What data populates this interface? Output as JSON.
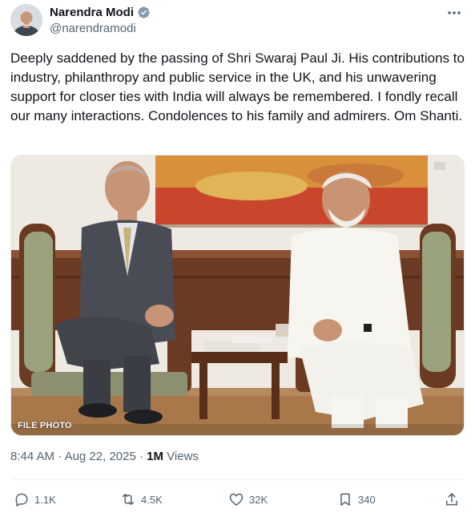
{
  "author": {
    "display_name": "Narendra Modi",
    "handle": "@narendramodi",
    "verified": true,
    "verified_color": "#829aab"
  },
  "post": {
    "text": "Deeply saddened by the passing of Shri Swaraj Paul Ji. His contributions to industry, philanthropy and public service in the UK, and his unwavering support for closer ties with India will always be remembered. I fondly recall our many interactions. Condolences to his family and admirers. Om Shanti.",
    "media_label": "FILE PHOTO",
    "time": "8:44 AM",
    "separator": " · ",
    "date": "Aug 22, 2025",
    "views_count": "1M",
    "views_label": " Views"
  },
  "actions": {
    "replies": "1.1K",
    "reposts": "4.5K",
    "likes": "32K",
    "bookmarks": "340"
  },
  "icons": {
    "more": "more-icon",
    "verified": "verified-badge-icon",
    "reply": "reply-icon",
    "repost": "repost-icon",
    "like": "heart-icon",
    "bookmark": "bookmark-icon",
    "share": "share-icon"
  },
  "colors": {
    "text_primary": "#0f1419",
    "text_secondary": "#536471",
    "divider": "#eff3f4"
  }
}
